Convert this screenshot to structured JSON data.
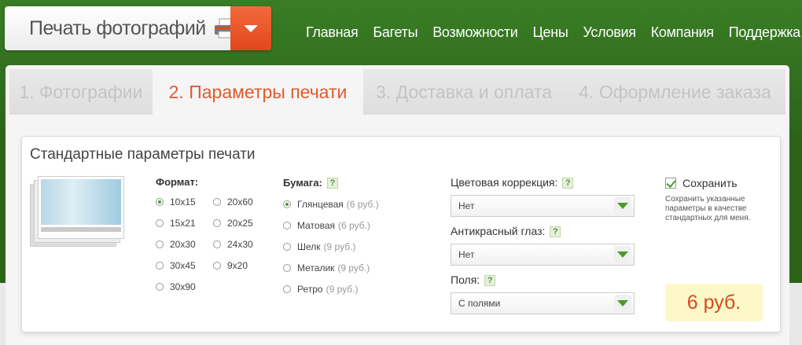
{
  "header": {
    "logo_text": "Печать фотографий",
    "nav": [
      "Главная",
      "Багеты",
      "Возможности",
      "Цены",
      "Условия",
      "Компания",
      "Поддержка"
    ]
  },
  "colors": {
    "accent": "#e15a2d",
    "green": "#4a9b2c",
    "bg": "#2f6d1f"
  },
  "tabs": [
    {
      "label": "1. Фотографии",
      "active": false
    },
    {
      "label": "2. Параметры печати",
      "active": true
    },
    {
      "label": "3. Доставка и оплата",
      "active": false
    },
    {
      "label": "4. Оформление заказа",
      "active": false
    }
  ],
  "card": {
    "title": "Стандартные параметры печати",
    "format": {
      "label": "Формат:",
      "col1": [
        "10x15",
        "15x21",
        "20x30",
        "30x45",
        "30x90"
      ],
      "col2": [
        "20x60",
        "20x25",
        "24x30",
        "9x20"
      ],
      "selected": "10x15"
    },
    "paper": {
      "label": "Бумага:",
      "help": "?",
      "options": [
        {
          "name": "Глянцевая",
          "price": "(6 руб.)"
        },
        {
          "name": "Матовая",
          "price": "(6 руб.)"
        },
        {
          "name": "Шелк",
          "price": "(9 руб.)"
        },
        {
          "name": "Металик",
          "price": "(9 руб.)"
        },
        {
          "name": "Ретро",
          "price": "(9 руб.)"
        }
      ],
      "selected": "Глянцевая"
    },
    "color_correction": {
      "label": "Цветовая коррекция:",
      "help": "?",
      "value": "Нет"
    },
    "red_eye": {
      "label": "Антикрасный глаз:",
      "help": "?",
      "value": "Нет"
    },
    "margins": {
      "label": "Поля:",
      "help": "?",
      "value": "С полями"
    },
    "save": {
      "label": "Сохранить",
      "checked": true,
      "note": "Сохранить указанные параметры в качестве стандартных для меня."
    },
    "price": "6 руб."
  }
}
